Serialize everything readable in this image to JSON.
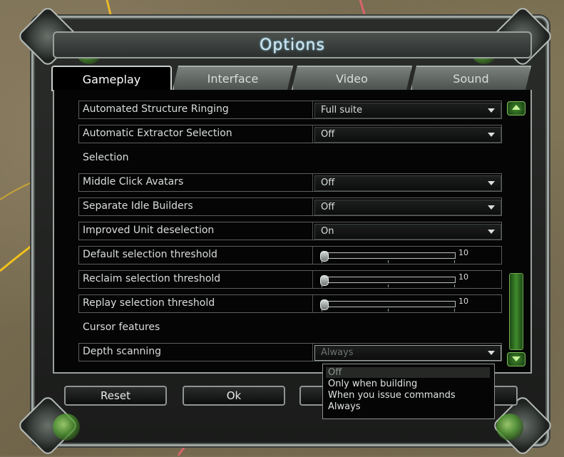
{
  "window": {
    "title": "Options"
  },
  "tabs": [
    {
      "label": "Gameplay",
      "active": true
    },
    {
      "label": "Interface",
      "active": false
    },
    {
      "label": "Video",
      "active": false
    },
    {
      "label": "Sound",
      "active": false
    }
  ],
  "rows": [
    {
      "label": "Automated Structure Ringing",
      "value": "Full suite"
    },
    {
      "label": "Automatic Extractor Selection",
      "value": "Off"
    },
    {
      "label": "Middle Click Avatars",
      "value": "Off"
    },
    {
      "label": "Separate Idle Builders",
      "value": "Off"
    },
    {
      "label": "Improved Unit deselection",
      "value": "On"
    },
    {
      "label": "Default selection threshold",
      "max_label": "10",
      "slider_fraction": 0
    },
    {
      "label": "Reclaim selection threshold",
      "max_label": "10",
      "slider_fraction": 0
    },
    {
      "label": "Replay selection threshold",
      "max_label": "10",
      "slider_fraction": 0
    },
    {
      "label": "Depth scanning",
      "value": "Always"
    }
  ],
  "sections": {
    "selection": "Selection",
    "cursor": "Cursor features"
  },
  "depth_dropdown": {
    "options": [
      "Off",
      "Only when building",
      "When you issue commands",
      "Always"
    ],
    "highlighted": "Off"
  },
  "buttons": {
    "reset": "Reset",
    "ok": "Ok"
  },
  "icons": {
    "dropdown": "chevron-down-icon",
    "scroll_up": "scroll-up-icon",
    "scroll_down": "scroll-down-icon"
  },
  "colors": {
    "accent_green": "#3f8a2b",
    "title_glow": "#6ab7d9"
  }
}
